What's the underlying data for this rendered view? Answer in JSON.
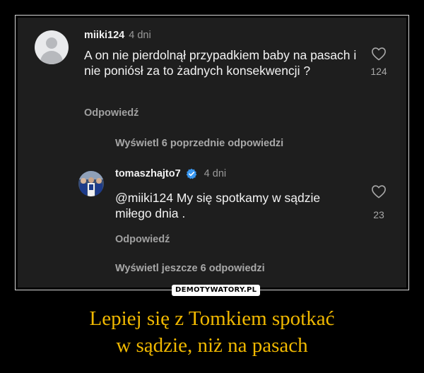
{
  "comment": {
    "username": "miiki124",
    "time": "4 dni",
    "text": "A on nie pierdolnął przypadkiem baby na pasach i nie poniósł za to żadnych konsekwencji ?",
    "reply_label": "Odpowiedź",
    "likes": "124"
  },
  "view_previous": "Wyświetl 6 poprzednie odpowiedzi",
  "reply": {
    "username": "tomaszhajto7",
    "time": "4 dni",
    "mention": "@miiki124",
    "text": " My się spotkamy w sądzie miłego dnia .",
    "reply_label": "Odpowiedź",
    "likes": "23"
  },
  "view_more": "Wyświetl jeszcze 6 odpowiedzi",
  "watermark": "DEMOTYWATORY.PL",
  "caption": {
    "line1": "Lepiej się z Tomkiem spotkać",
    "line2": "w sądzie, niż na pasach"
  },
  "colors": {
    "background": "#000000",
    "panel": "#1e1e1e",
    "caption": "#f0b800",
    "verified": "#3897f0"
  }
}
